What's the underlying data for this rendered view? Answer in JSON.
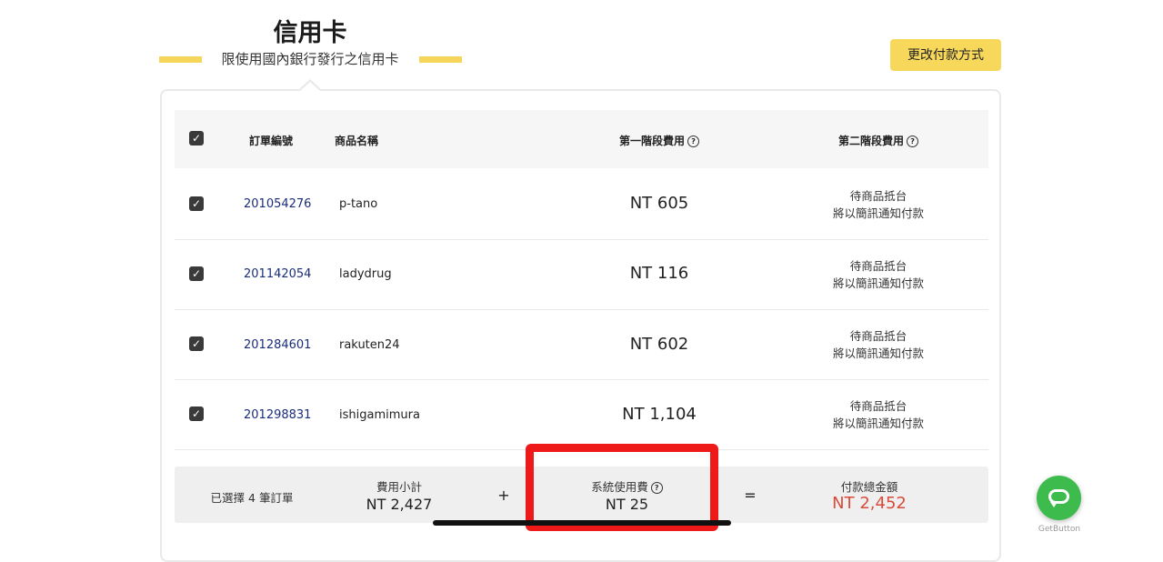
{
  "header": {
    "title": "信用卡",
    "subtitle": "限使用國內銀行發行之信用卡",
    "change_button": "更改付款方式"
  },
  "table": {
    "headers": {
      "order_no": "訂單編號",
      "product": "商品名稱",
      "stage1": "第一階段費用",
      "stage2": "第二階段費用"
    },
    "rows": [
      {
        "order_no": "201054276",
        "product": "p-tano",
        "stage1": "NT 605",
        "stage2_line1": "待商品抵台",
        "stage2_line2": "將以簡訊通知付款"
      },
      {
        "order_no": "201142054",
        "product": "ladydrug",
        "stage1": "NT 116",
        "stage2_line1": "待商品抵台",
        "stage2_line2": "將以簡訊通知付款"
      },
      {
        "order_no": "201284601",
        "product": "rakuten24",
        "stage1": "NT 602",
        "stage2_line1": "待商品抵台",
        "stage2_line2": "將以簡訊通知付款"
      },
      {
        "order_no": "201298831",
        "product": "ishigamimura",
        "stage1": "NT 1,104",
        "stage2_line1": "待商品抵台",
        "stage2_line2": "將以簡訊通知付款"
      }
    ]
  },
  "summary": {
    "selected": "已選擇 4 筆訂單",
    "subtotal_label": "費用小計",
    "subtotal_value": "NT 2,427",
    "plus": "+",
    "fee_label": "系統使用費",
    "fee_value": "NT 25",
    "equals": "=",
    "total_label": "付款總金額",
    "total_value": "NT 2,452"
  },
  "widget": {
    "label": "GetButton"
  },
  "colors": {
    "accent_yellow": "#f7d85b",
    "total_red": "#d84b3a",
    "order_link": "#1a2d7a",
    "annotation_red": "#ee1a1a",
    "chat_green": "#3dbb4d"
  },
  "help_glyph": "?",
  "check_glyph": "✓"
}
